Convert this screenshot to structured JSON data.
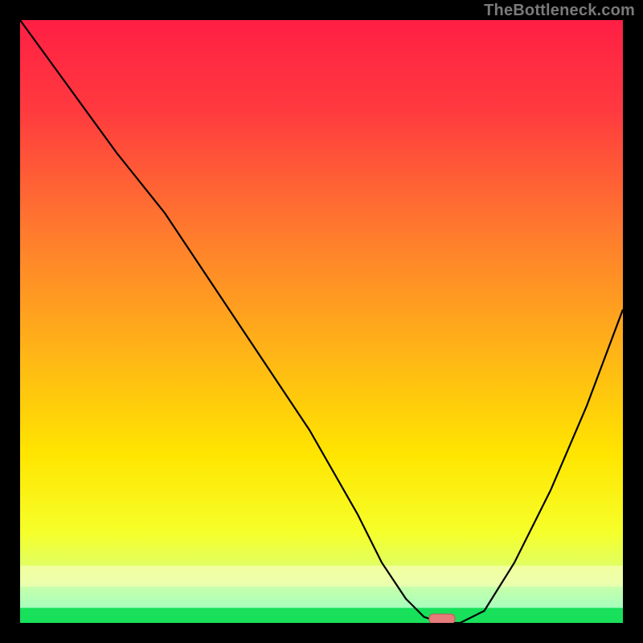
{
  "watermark": "TheBottleneck.com",
  "colors": {
    "page_bg": "#000000",
    "curve": "#000000",
    "marker_fill": "#e77a7a",
    "marker_stroke": "#c95858"
  },
  "gradient_stops": [
    {
      "offset": 0.0,
      "color": "#ff1f44"
    },
    {
      "offset": 0.15,
      "color": "#ff3a3f"
    },
    {
      "offset": 0.35,
      "color": "#ff7a2e"
    },
    {
      "offset": 0.55,
      "color": "#ffb417"
    },
    {
      "offset": 0.72,
      "color": "#ffe500"
    },
    {
      "offset": 0.85,
      "color": "#f6ff2a"
    },
    {
      "offset": 0.93,
      "color": "#d8ff7a"
    },
    {
      "offset": 0.975,
      "color": "#7dffb0"
    },
    {
      "offset": 1.0,
      "color": "#18e05a"
    }
  ],
  "bands": [
    {
      "y": 0.905,
      "h": 0.035,
      "color": "rgba(255,255,210,0.55)"
    },
    {
      "y": 0.94,
      "h": 0.035,
      "color": "rgba(200,255,200,0.55)"
    },
    {
      "y": 0.975,
      "h": 0.025,
      "color": "#18e05a"
    }
  ],
  "chart_data": {
    "type": "line",
    "title": "",
    "xlabel": "",
    "ylabel": "",
    "xlim": [
      0,
      100
    ],
    "ylim": [
      0,
      100
    ],
    "x": [
      0,
      8,
      16,
      24,
      32,
      40,
      48,
      56,
      60,
      64,
      67,
      70,
      73,
      77,
      82,
      88,
      94,
      100
    ],
    "values": [
      100,
      89,
      78,
      68,
      56,
      44,
      32,
      18,
      10,
      4,
      1,
      0,
      0,
      2,
      10,
      22,
      36,
      52
    ],
    "marker": {
      "x": 70,
      "y": 0
    },
    "gridlines": false,
    "legend": false
  }
}
